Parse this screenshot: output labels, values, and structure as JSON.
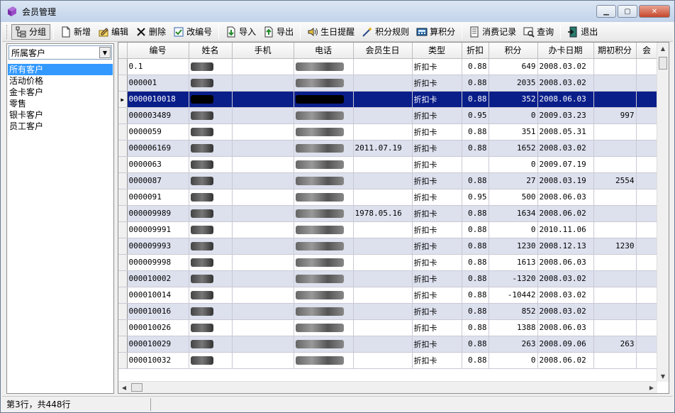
{
  "window": {
    "title": "会员管理"
  },
  "toolbar": {
    "group": "分组",
    "add": "新增",
    "edit": "编辑",
    "delete": "删除",
    "renumber": "改编号",
    "import": "导入",
    "export": "导出",
    "birthday": "生日提醒",
    "points_rule": "积分规则",
    "calc_points": "算积分",
    "consume_record": "消费记录",
    "query": "查询",
    "exit": "退出"
  },
  "sidebar": {
    "combo_value": "所属客户",
    "items": [
      "所有客户",
      "活动价格",
      "金卡客户",
      "零售",
      "银卡客户",
      "员工客户"
    ]
  },
  "grid": {
    "columns": [
      "编号",
      "姓名",
      "手机",
      "电话",
      "会员生日",
      "类型",
      "折扣",
      "积分",
      "办卡日期",
      "期初积分",
      "会"
    ],
    "rows": [
      {
        "id": "0.1",
        "birthday": "",
        "type": "折扣卡",
        "discount": "0.88",
        "points": "649",
        "card_date": "2008.03.02",
        "initial": ""
      },
      {
        "id": "000001",
        "birthday": "",
        "type": "折扣卡",
        "discount": "0.88",
        "points": "2035",
        "card_date": "2008.03.02",
        "initial": ""
      },
      {
        "id": "0000010018",
        "birthday": "",
        "type": "折扣卡",
        "discount": "0.88",
        "points": "352",
        "card_date": "2008.06.03",
        "initial": ""
      },
      {
        "id": "000003489",
        "birthday": "",
        "type": "折扣卡",
        "discount": "0.95",
        "points": "0",
        "card_date": "2009.03.23",
        "initial": "997"
      },
      {
        "id": "0000059",
        "birthday": "",
        "type": "折扣卡",
        "discount": "0.88",
        "points": "351",
        "card_date": "2008.05.31",
        "initial": ""
      },
      {
        "id": "000006169",
        "birthday": "2011.07.19",
        "type": "折扣卡",
        "discount": "0.88",
        "points": "1652",
        "card_date": "2008.03.02",
        "initial": ""
      },
      {
        "id": "0000063",
        "birthday": "",
        "type": "折扣卡",
        "discount": "",
        "points": "0",
        "card_date": "2009.07.19",
        "initial": ""
      },
      {
        "id": "0000087",
        "birthday": "",
        "type": "折扣卡",
        "discount": "0.88",
        "points": "27",
        "card_date": "2008.03.19",
        "initial": "2554"
      },
      {
        "id": "0000091",
        "birthday": "",
        "type": "折扣卡",
        "discount": "0.95",
        "points": "500",
        "card_date": "2008.06.03",
        "initial": ""
      },
      {
        "id": "000009989",
        "birthday": "1978.05.16",
        "type": "折扣卡",
        "discount": "0.88",
        "points": "1634",
        "card_date": "2008.06.02",
        "initial": ""
      },
      {
        "id": "000009991",
        "birthday": "",
        "type": "折扣卡",
        "discount": "0.88",
        "points": "0",
        "card_date": "2010.11.06",
        "initial": ""
      },
      {
        "id": "000009993",
        "birthday": "",
        "type": "折扣卡",
        "discount": "0.88",
        "points": "1230",
        "card_date": "2008.12.13",
        "initial": "1230"
      },
      {
        "id": "000009998",
        "birthday": "",
        "type": "折扣卡",
        "discount": "0.88",
        "points": "1613",
        "card_date": "2008.06.03",
        "initial": ""
      },
      {
        "id": "000010002",
        "birthday": "",
        "type": "折扣卡",
        "discount": "0.88",
        "points": "-1320",
        "card_date": "2008.03.02",
        "initial": ""
      },
      {
        "id": "000010014",
        "birthday": "",
        "type": "折扣卡",
        "discount": "0.88",
        "points": "-10442",
        "card_date": "2008.03.02",
        "initial": ""
      },
      {
        "id": "000010016",
        "birthday": "",
        "type": "折扣卡",
        "discount": "0.88",
        "points": "852",
        "card_date": "2008.03.02",
        "initial": ""
      },
      {
        "id": "000010026",
        "birthday": "",
        "type": "折扣卡",
        "discount": "0.88",
        "points": "1388",
        "card_date": "2008.06.03",
        "initial": ""
      },
      {
        "id": "000010029",
        "birthday": "",
        "type": "折扣卡",
        "discount": "0.88",
        "points": "263",
        "card_date": "2008.09.06",
        "initial": "263"
      },
      {
        "id": "000010032",
        "birthday": "",
        "type": "折扣卡",
        "discount": "0.88",
        "points": "0",
        "card_date": "2008.06.02",
        "initial": ""
      }
    ]
  },
  "status": {
    "text": "第3行，共448行"
  }
}
